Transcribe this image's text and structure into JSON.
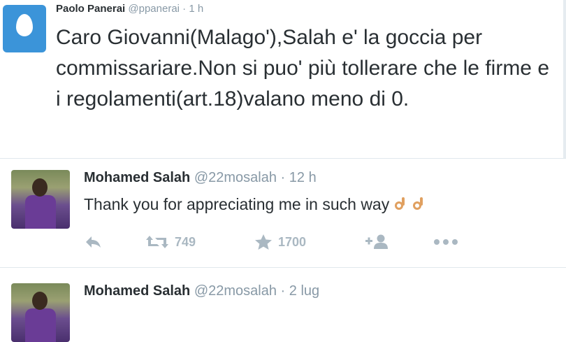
{
  "tweets": [
    {
      "name": "Paolo Panerai",
      "handle": "@ppanerai",
      "separator": "·",
      "time": "1 h",
      "text": "Caro Giovanni(Malago'),Salah e' la goccia per commissariare.Non si puo' più tollerare che le firme e i regolamenti(art.18)valano meno di 0.",
      "avatar_icon": "egg-avatar-icon"
    },
    {
      "name": "Mohamed Salah",
      "handle": "@22mosalah",
      "separator": "·",
      "time": "12 h",
      "text": "Thank you for appreciating me in such way",
      "emoji": "ok-hand-emoji",
      "retweets": "749",
      "favorites": "1700"
    },
    {
      "name": "Mohamed Salah",
      "handle": "@22mosalah",
      "separator": "·",
      "time": "2 lug"
    }
  ],
  "colors": {
    "egg_background": "#3b94d9",
    "muted_text": "#8899a6",
    "action_icon": "#aab8c2",
    "body_text": "#292f33",
    "divider": "#e1e8ed"
  },
  "icons": {
    "reply": "reply-icon",
    "retweet": "retweet-icon",
    "favorite": "star-icon",
    "follow": "follow-icon",
    "more": "more-icon"
  }
}
